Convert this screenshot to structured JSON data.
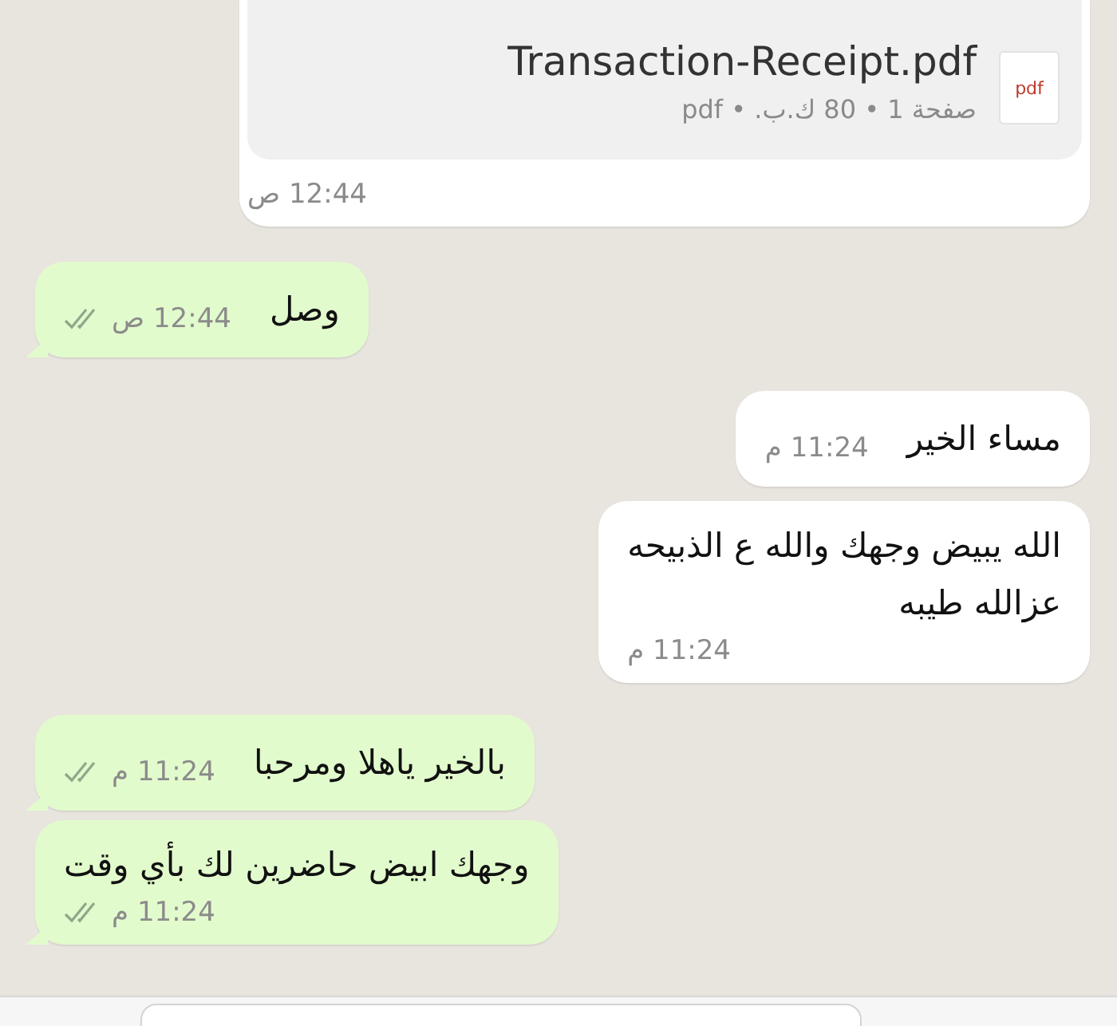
{
  "messages": [
    {
      "kind": "document",
      "outgoing": false,
      "file_type": "pdf",
      "file_name": "Transaction-Receipt.pdf",
      "meta": "صفحة 1 • 80 ك.ب. • pdf",
      "time": "12:44 ص"
    },
    {
      "kind": "inline",
      "outgoing": true,
      "lines": [
        "وصل"
      ],
      "time": "12:44 ص"
    },
    {
      "kind": "inline",
      "outgoing": false,
      "lines": [
        "مساء الخير"
      ],
      "time": "11:24 م"
    },
    {
      "kind": "stacked",
      "outgoing": false,
      "lines": [
        "الله يبيض وجهك والله ع الذبيحه",
        "عزالله طيبه"
      ],
      "time": "11:24 م"
    },
    {
      "kind": "inline",
      "outgoing": true,
      "lines": [
        "بالخير ياهلا ومرحبا"
      ],
      "time": "11:24 م"
    },
    {
      "kind": "stacked",
      "outgoing": true,
      "lines": [
        "وجهك ابيض حاضرين لك بأي وقت"
      ],
      "time": "11:24 م"
    }
  ]
}
